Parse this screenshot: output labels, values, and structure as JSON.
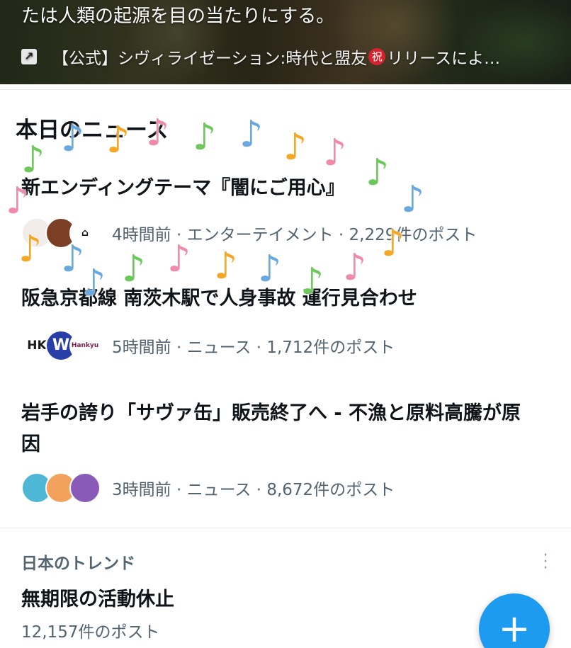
{
  "promo": {
    "text": "たは人類の起源を目の当たりにする。",
    "link_icon": "↗",
    "link_text_1": "【公式】シヴィライゼーション:時代と盟友",
    "badge": "祝",
    "link_text_2": "リリースによ…"
  },
  "news": {
    "section_title": "本日のニュース",
    "items": [
      {
        "title": "新エンディングテーマ『闇にご用心』",
        "meta": "4時間前 · エンターテイメント · 2,229件のポスト",
        "avatars": [
          "",
          "",
          ""
        ]
      },
      {
        "title": "阪急京都線 南茨木駅で人身事故 運行見合わせ",
        "meta": "5時間前 · ニュース · 1,712件のポスト",
        "avatars": [
          "HK",
          "W",
          "Hankyu"
        ]
      },
      {
        "title_line1": "岩手の誇り「サヴァ缶」販売終了へ - 不漁と原料高騰が原",
        "title_line2": "因",
        "meta": "3時間前 · ニュース · 8,672件のポスト",
        "avatars": [
          "",
          "",
          ""
        ]
      }
    ]
  },
  "trend": {
    "label": "日本のトレンド",
    "title": "無期限の活動休止",
    "count": "12,157件のポスト",
    "more_icon": "more-vertical-icon"
  },
  "fab": {
    "label": "+",
    "icon": "compose-plus-icon"
  },
  "colors": {
    "accent": "#1d9bf0",
    "secondary_text": "#536471",
    "note_green": "#6cc85a",
    "note_blue": "#6aa8e0",
    "note_orange": "#f5a623",
    "note_pink": "#f08aa8"
  },
  "overlay": {
    "notes": "♪"
  }
}
